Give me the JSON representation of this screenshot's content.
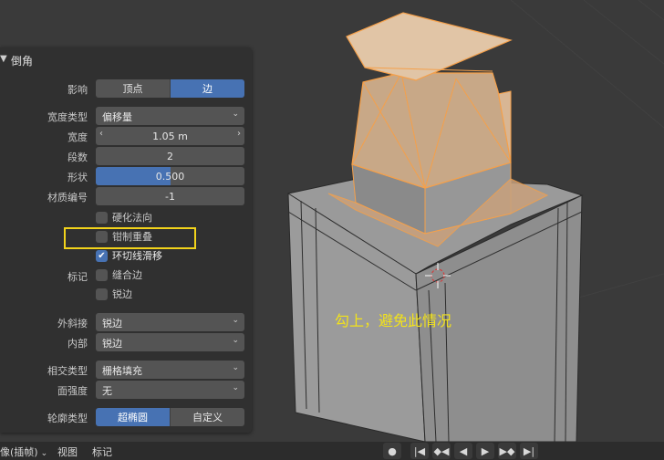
{
  "panel": {
    "title": "倒角",
    "rows": {
      "affect": {
        "label": "影响",
        "options": [
          "顶点",
          "边"
        ],
        "selected_index": 1
      },
      "width_type": {
        "label": "宽度类型",
        "value": "偏移量"
      },
      "width": {
        "label": "宽度",
        "value": "1.05 m"
      },
      "segments": {
        "label": "段数",
        "value": "2"
      },
      "shape": {
        "label": "形状",
        "value": "0.500",
        "fraction": 0.5
      },
      "material": {
        "label": "材质编号",
        "value": "-1"
      },
      "harden_normals": {
        "label": "硬化法向",
        "checked": false
      },
      "clamp_overlap": {
        "label": "钳制重叠",
        "checked": false
      },
      "loop_slide": {
        "label": "环切线滑移",
        "checked": true
      },
      "mark": {
        "label": "标记"
      },
      "mark_seam": {
        "label": "缝合边",
        "checked": false
      },
      "mark_sharp": {
        "label": "锐边",
        "checked": false
      },
      "miter_outer": {
        "label": "外斜接",
        "value": "锐边"
      },
      "miter_inner": {
        "label": "内部",
        "value": "锐边"
      },
      "intersection_type": {
        "label": "相交类型",
        "value": "栅格填充"
      },
      "face_strength": {
        "label": "面强度",
        "value": "无"
      },
      "profile_type": {
        "label": "轮廓类型",
        "options": [
          "超椭圆",
          "自定义"
        ],
        "selected_index": 0
      }
    }
  },
  "annotation": {
    "text": "勾上，避免此情况"
  },
  "bottombar": {
    "mode_label": "像(插帧)",
    "menu": [
      "视图",
      "标记"
    ]
  },
  "colors": {
    "accent": "#4772b3",
    "highlight": "#f2d31b",
    "annotation": "#f2e21b",
    "panel_bg": "#303030",
    "viewport_bg": "#3a3a3a",
    "selection_orange": "#f5a04a"
  }
}
